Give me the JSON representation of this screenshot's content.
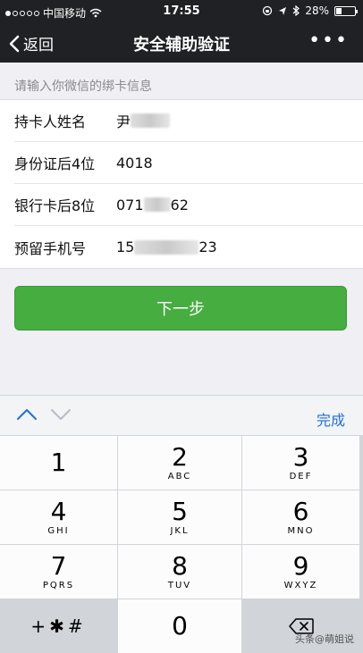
{
  "status_bar": {
    "carrier": "中国移动",
    "time": "17:55",
    "battery_text": "28%",
    "battery_level": 0.28
  },
  "nav": {
    "back_label": "返回",
    "title": "安全辅助验证",
    "more_label": "•••"
  },
  "form": {
    "hint": "请输入你微信的绑卡信息",
    "rows": [
      {
        "label": "持卡人姓名",
        "value_prefix": "尹",
        "value_suffix": ""
      },
      {
        "label": "身份证后4位",
        "value_prefix": "4018",
        "value_suffix": ""
      },
      {
        "label": "银行卡后8位",
        "value_prefix": "071",
        "value_suffix": "62"
      },
      {
        "label": "预留手机号",
        "value_prefix": "15",
        "value_suffix": "23"
      }
    ]
  },
  "next_button": {
    "label": "下一步",
    "color": "#46ad41"
  },
  "keyboard": {
    "done_label": "完成",
    "keys": [
      {
        "num": "1",
        "letters": ""
      },
      {
        "num": "2",
        "letters": "ABC"
      },
      {
        "num": "3",
        "letters": "DEF"
      },
      {
        "num": "4",
        "letters": "GHI"
      },
      {
        "num": "5",
        "letters": "JKL"
      },
      {
        "num": "6",
        "letters": "MNO"
      },
      {
        "num": "7",
        "letters": "PQRS"
      },
      {
        "num": "8",
        "letters": "TUV"
      },
      {
        "num": "9",
        "letters": "WXYZ"
      }
    ],
    "symbols_label": "+✱#",
    "zero": "0"
  },
  "watermark": "头条@萌姐说"
}
